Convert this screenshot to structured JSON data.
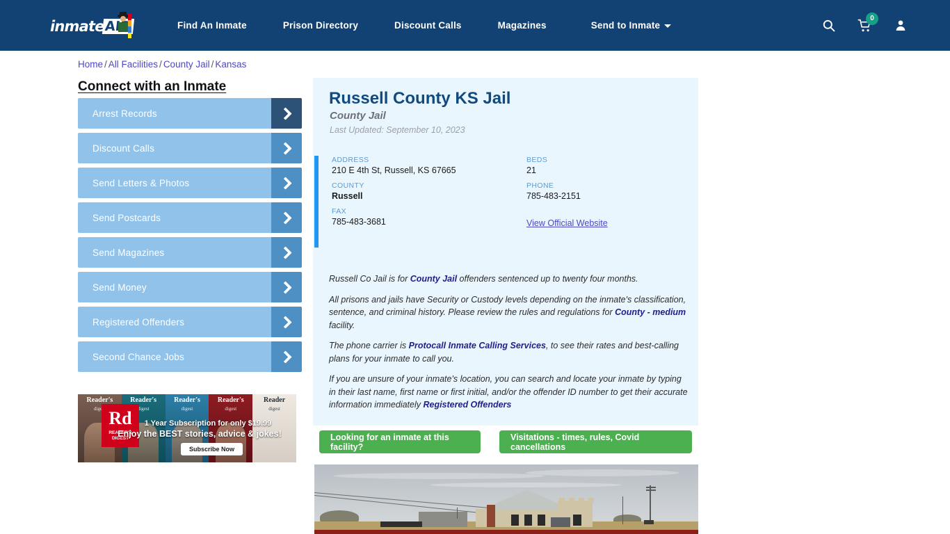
{
  "header": {
    "logo_text": "inmate",
    "logo_badge": "AID",
    "nav": [
      {
        "label": "Find An Inmate"
      },
      {
        "label": "Prison Directory"
      },
      {
        "label": "Discount Calls"
      },
      {
        "label": "Magazines"
      },
      {
        "label": "Send to Inmate"
      }
    ],
    "icons": {
      "search": "search-icon",
      "cart": "cart-icon",
      "cart_count": "0",
      "account": "user-icon"
    },
    "colors": {
      "bar": "#114273",
      "badge": "#16a085"
    }
  },
  "breadcrumb": {
    "items": [
      "Home",
      "All Facilities",
      "County Jail",
      "Kansas"
    ],
    "separator": "/"
  },
  "sidebar": {
    "title": "Connect with an Inmate",
    "items": [
      {
        "label": "Arrest Records"
      },
      {
        "label": "Discount Calls"
      },
      {
        "label": "Send Letters & Photos"
      },
      {
        "label": "Send Postcards"
      },
      {
        "label": "Send Magazines"
      },
      {
        "label": "Send Money"
      },
      {
        "label": "Registered Offenders"
      },
      {
        "label": "Second Chance Jobs"
      }
    ]
  },
  "ad": {
    "brand_initials": "Rd",
    "brand_name": "READER'S DIGEST",
    "line1": "1 Year Subscription for only $19.99",
    "line2": "Enjoy the BEST stories, advice & jokes!",
    "cta": "Subscribe Now",
    "covers": [
      {
        "title": "Reader's",
        "sub": "digest"
      },
      {
        "title": "Reader's",
        "sub": "digest"
      },
      {
        "title": "Reader's",
        "sub": "digest"
      },
      {
        "title": "Reader's",
        "sub": "digest"
      },
      {
        "title": "Reader",
        "sub": "digest"
      }
    ]
  },
  "facility": {
    "name": "Russell County KS Jail",
    "type": "County Jail",
    "last_updated": "Last Updated: September 10, 2023",
    "fields": {
      "address_label": "ADDRESS",
      "address_value": "210 E 4th St, Russell, KS 67665",
      "beds_label": "BEDS",
      "beds_value": "21",
      "county_label": "COUNTY",
      "county_value": "Russell",
      "phone_label": "PHONE",
      "phone_value": "785-483-2151",
      "fax_label": "FAX",
      "fax_value": "785-483-3681",
      "website_link": "View Official Website"
    },
    "paragraphs": [
      {
        "parts": [
          {
            "t": "Russell Co Jail is for ",
            "link": false
          },
          {
            "t": "County Jail",
            "link": true
          },
          {
            "t": " offenders sentenced up to twenty four months.",
            "link": false
          }
        ]
      },
      {
        "parts": [
          {
            "t": "All prisons and jails have Security or Custody levels depending on the inmate's classification, sentence, and criminal history. Please review the rules and regulations for ",
            "link": false
          },
          {
            "t": "County - medium",
            "link": true
          },
          {
            "t": " facility.",
            "link": false
          }
        ]
      },
      {
        "parts": [
          {
            "t": "The phone carrier is ",
            "link": false
          },
          {
            "t": "Protocall Inmate Calling Services",
            "link": true
          },
          {
            "t": ", to see their rates and best-calling plans for your inmate to call you.",
            "link": false
          }
        ]
      },
      {
        "parts": [
          {
            "t": "If you are unsure of your inmate's location, you can search and locate your inmate by typing in their last name, first name or first initial, and/or the offender ID number to get their accurate information immediately ",
            "link": false
          },
          {
            "t": "Registered Offenders",
            "link": true
          }
        ]
      }
    ]
  },
  "actions": {
    "find_inmate": "Looking for an inmate at this facility?",
    "visitations": "Visitations - times, rules, Covid cancellations"
  },
  "colors": {
    "accent_bar": "#2196f3",
    "panel_bg": "#eaf6fd",
    "green_button": "#4caf50",
    "sidebar_button": "#91c3ea",
    "link": "#4e46c8"
  }
}
